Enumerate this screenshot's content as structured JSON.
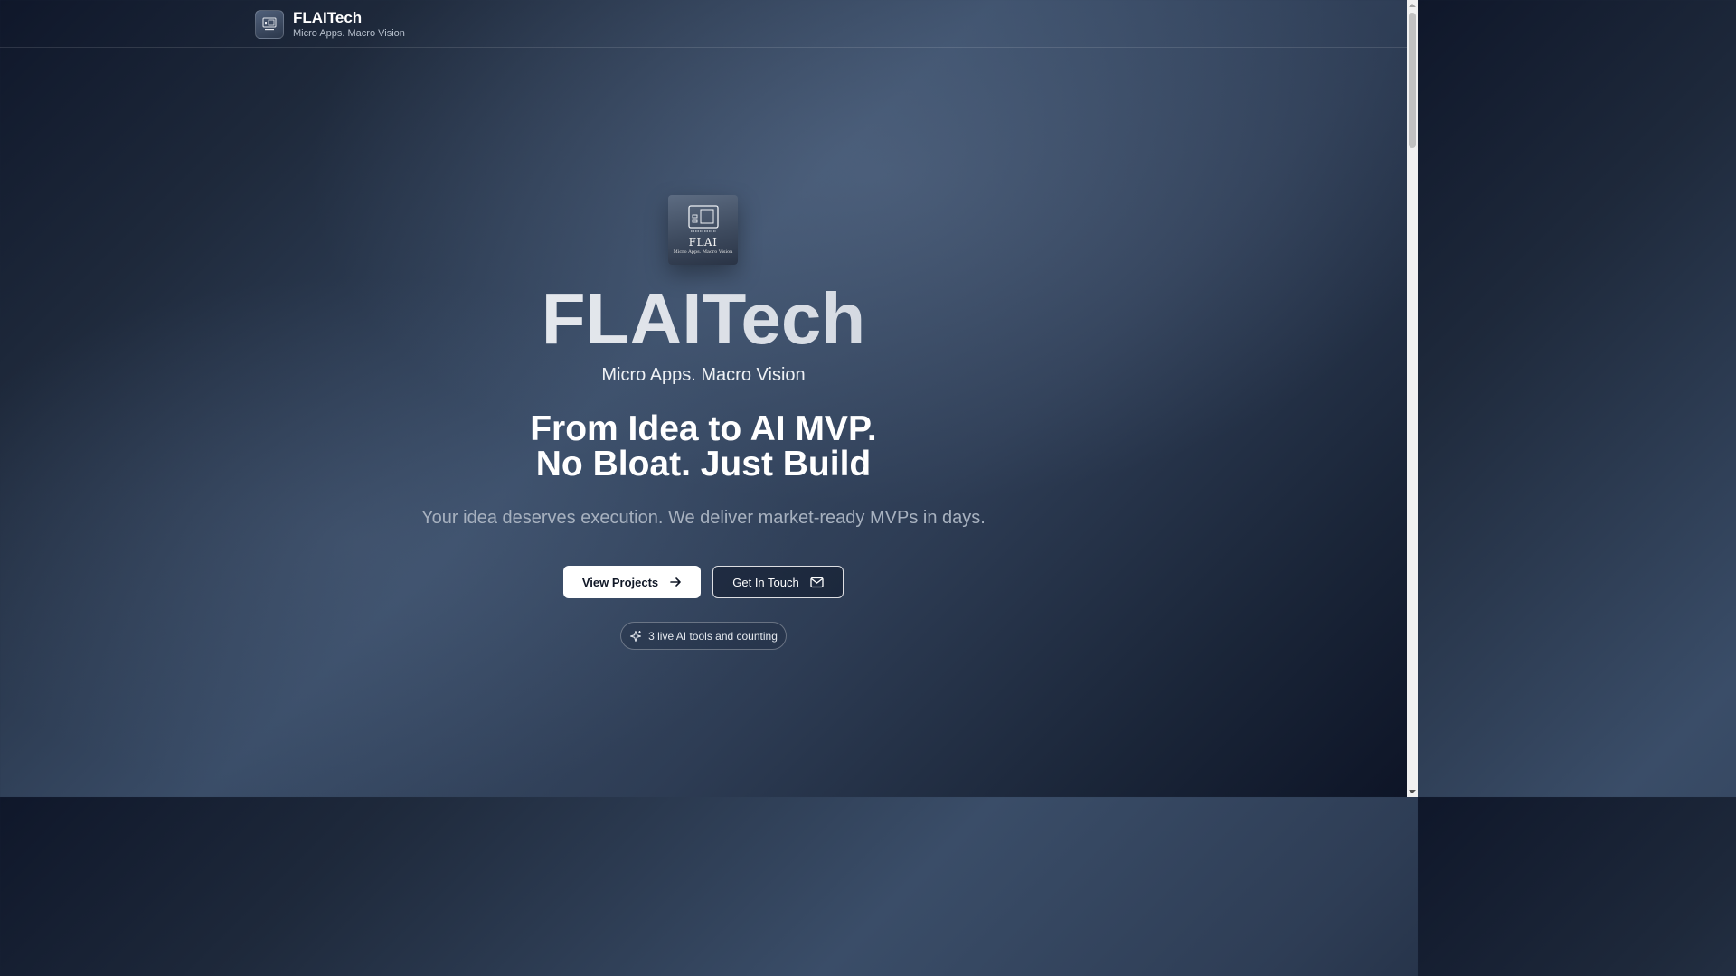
{
  "header": {
    "brand_name": "FLAITech",
    "brand_tagline": "Micro Apps. Macro Vision",
    "logo_icon": "flai-logo-icon"
  },
  "hero": {
    "logo_word": "FLAI",
    "logo_tagline": "Micro Apps. Macro Vision",
    "title": "FLAITech",
    "subtitle": "Micro Apps. Macro Vision",
    "headline_line1": "From Idea to AI MVP.",
    "headline_line2": "No Bloat. Just Build",
    "description": "Your idea deserves execution. We deliver market-ready MVPs in days.",
    "primary_button": {
      "label": "View Projects",
      "icon": "arrow-right-icon"
    },
    "secondary_button": {
      "label": "Get In Touch",
      "icon": "mail-icon"
    },
    "badge": {
      "label": "3 live AI tools and counting",
      "icon": "sparkles-icon"
    }
  },
  "colors": {
    "background_dark": "#0f172a",
    "background_mid": "#3a4d68",
    "primary_button_bg": "#ffffff",
    "primary_button_text": "#111827",
    "muted_text": "#a7b1bf"
  }
}
